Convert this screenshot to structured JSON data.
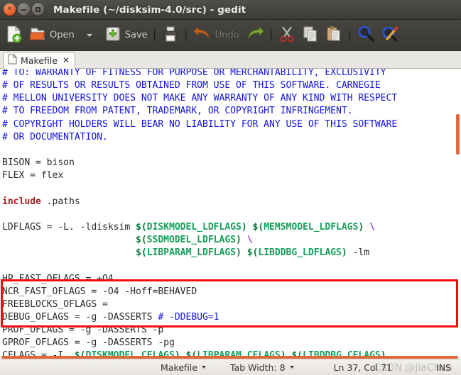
{
  "window": {
    "title": "Makefile (~/disksim-4.0/src) - gedit",
    "close_glyph": "×",
    "buttons": {
      "close": "close",
      "minimize": "minimize",
      "maximize": "maximize"
    }
  },
  "toolbar": {
    "new_label": "",
    "open_label": "Open",
    "save_label": "Save",
    "print_label": "",
    "undo_label": "Undo",
    "redo_label": "",
    "cut_label": "",
    "copy_label": "",
    "paste_label": "",
    "find_label": "",
    "replace_label": ""
  },
  "tabs": [
    {
      "name": "Makefile",
      "close": "✕"
    }
  ],
  "editor": {
    "lines": [
      {
        "type": "comment",
        "text": "# TO: WARRANTY OF FITNESS FOR PURPOSE OR MERCHANTABILITY, EXCLUSIVITY"
      },
      {
        "type": "comment",
        "text": "# OF RESULTS OR RESULTS OBTAINED FROM USE OF THIS SOFTWARE. CARNEGIE"
      },
      {
        "type": "comment",
        "text": "# MELLON UNIVERSITY DOES NOT MAKE ANY WARRANTY OF ANY KIND WITH RESPECT"
      },
      {
        "type": "comment",
        "text": "# TO FREEDOM FROM PATENT, TRADEMARK, OR COPYRIGHT INFRINGEMENT."
      },
      {
        "type": "comment",
        "text": "# COPYRIGHT HOLDERS WILL BEAR NO LIABILITY FOR ANY USE OF THIS SOFTWARE"
      },
      {
        "type": "comment",
        "text": "# OR DOCUMENTATION."
      },
      {
        "type": "blank",
        "text": ""
      },
      {
        "type": "plain",
        "text": "BISON = bison"
      },
      {
        "type": "plain",
        "text": "FLEX = flex"
      },
      {
        "type": "blank",
        "text": ""
      },
      {
        "type": "include",
        "text": "include .paths"
      },
      {
        "type": "blank",
        "text": ""
      },
      {
        "type": "ldflags1",
        "text": "LDFLAGS = -L. -ldisksim $(DISKMODEL_LDFLAGS) $(MEMSMODEL_LDFLAGS) \\"
      },
      {
        "type": "ldflags2",
        "text": "                        $(SSDMODEL_LDFLAGS) \\"
      },
      {
        "type": "ldflags3",
        "text": "                        $(LIBPARAM_LDFLAGS) $(LIBDDBG_LDFLAGS) -lm"
      },
      {
        "type": "blank",
        "text": ""
      },
      {
        "type": "plain",
        "text": "HP_FAST_OFLAGS = +O4"
      },
      {
        "type": "plain",
        "text": "NCR_FAST_OFLAGS = -O4 -Hoff=BEHAVED"
      },
      {
        "type": "plain",
        "text": "FREEBLOCKS_OFLAGS ="
      },
      {
        "type": "debug",
        "text": "DEBUG_OFLAGS = -g -DASSERTS # -DDEBUG=1"
      },
      {
        "type": "plain",
        "text": "PROF_OFLAGS = -g -DASSERTS -p"
      },
      {
        "type": "plain",
        "text": "GPROF_OFLAGS = -g -DASSERTS -pg"
      },
      {
        "type": "cflags",
        "text": "CFLAGS = -I. $(DISKMODEL_CFLAGS) $(LIBPARAM_CFLAGS) $(LIBDDBG_CFLAGS)"
      }
    ],
    "highlight_note": "red rectangle around LDFLAGS block"
  },
  "statusbar": {
    "language": "Makefile",
    "tab_width": "Tab Width: 8",
    "position": "Ln 37, Col 71",
    "insert_mode": "INS"
  },
  "watermark": "CSDN @jiaChen",
  "colors": {
    "comment": "#1414e0",
    "keyword": "#a52020",
    "variable": "#15a05a",
    "continuation": "#9b30d9",
    "highlight_box": "#f40c0c",
    "scrollbar": "#e0683c",
    "titlebar": "#45433f"
  }
}
